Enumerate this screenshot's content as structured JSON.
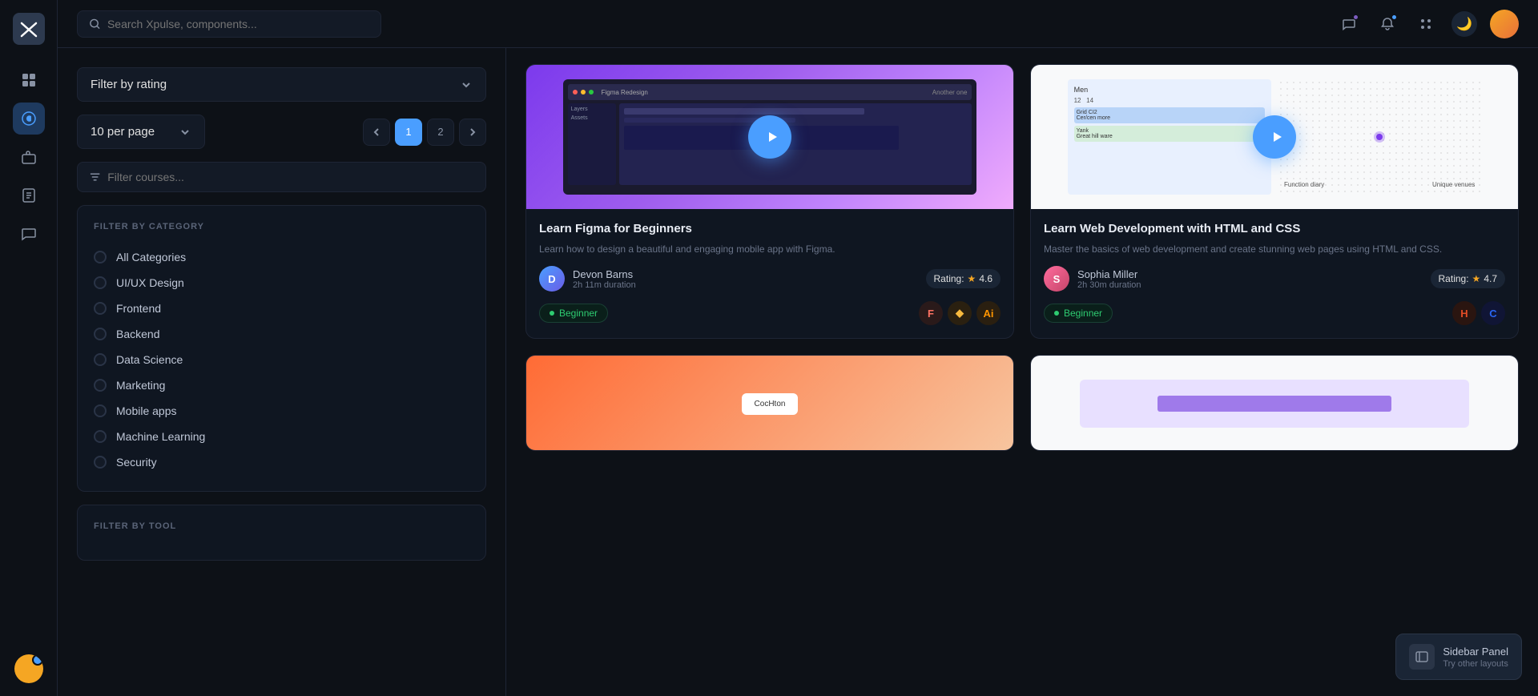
{
  "app": {
    "logo_symbol": "✕",
    "name": "Xpulse"
  },
  "topbar": {
    "search_placeholder": "Search Xpulse, components...",
    "theme_icon": "🌙"
  },
  "sidebar": {
    "icons": [
      {
        "name": "dashboard",
        "symbol": "⊞",
        "active": false
      },
      {
        "name": "courses",
        "symbol": "🎓",
        "active": true
      },
      {
        "name": "briefcase",
        "symbol": "💼",
        "active": false
      },
      {
        "name": "badge",
        "symbol": "🏅",
        "active": false
      },
      {
        "name": "chat",
        "symbol": "💬",
        "active": false
      }
    ]
  },
  "filters": {
    "rating_label": "Filter by rating",
    "rating_placeholder": "Filter by rating",
    "per_page_label": "10 per page",
    "search_placeholder": "Filter courses...",
    "category_section_title": "FILTER BY CATEGORY",
    "tool_section_title": "FILTER BY TOOL",
    "categories": [
      {
        "label": "All Categories",
        "selected": false
      },
      {
        "label": "UI/UX Design",
        "selected": false
      },
      {
        "label": "Frontend",
        "selected": false
      },
      {
        "label": "Backend",
        "selected": false
      },
      {
        "label": "Data Science",
        "selected": false
      },
      {
        "label": "Marketing",
        "selected": false
      },
      {
        "label": "Mobile apps",
        "selected": false
      },
      {
        "label": "Machine Learning",
        "selected": false
      },
      {
        "label": "Security",
        "selected": false
      }
    ]
  },
  "pagination": {
    "prev_label": "‹",
    "next_label": "›",
    "pages": [
      "1",
      "2"
    ],
    "active_page": "1"
  },
  "courses": [
    {
      "id": "figma",
      "title": "Learn Figma for Beginners",
      "description": "Learn how to design a beautiful and engaging mobile app with Figma.",
      "instructor_name": "Devon Barns",
      "instructor_duration": "2h 11m duration",
      "rating_label": "Rating:",
      "rating": "4.6",
      "level": "Beginner",
      "tools": [
        "F",
        "◆",
        "Ai"
      ],
      "tool_types": [
        "figma",
        "sketch",
        "ai"
      ]
    },
    {
      "id": "webdev",
      "title": "Learn Web Development with HTML and CSS",
      "description": "Master the basics of web development and create stunning web pages using HTML and CSS.",
      "instructor_name": "Sophia Miller",
      "instructor_duration": "2h 30m duration",
      "rating_label": "Rating:",
      "rating": "4.7",
      "level": "Beginner",
      "tools": [
        "H",
        "C"
      ],
      "tool_types": [
        "html",
        "css"
      ]
    }
  ],
  "tooltip": {
    "title": "Sidebar Panel",
    "subtitle": "Try other layouts"
  }
}
